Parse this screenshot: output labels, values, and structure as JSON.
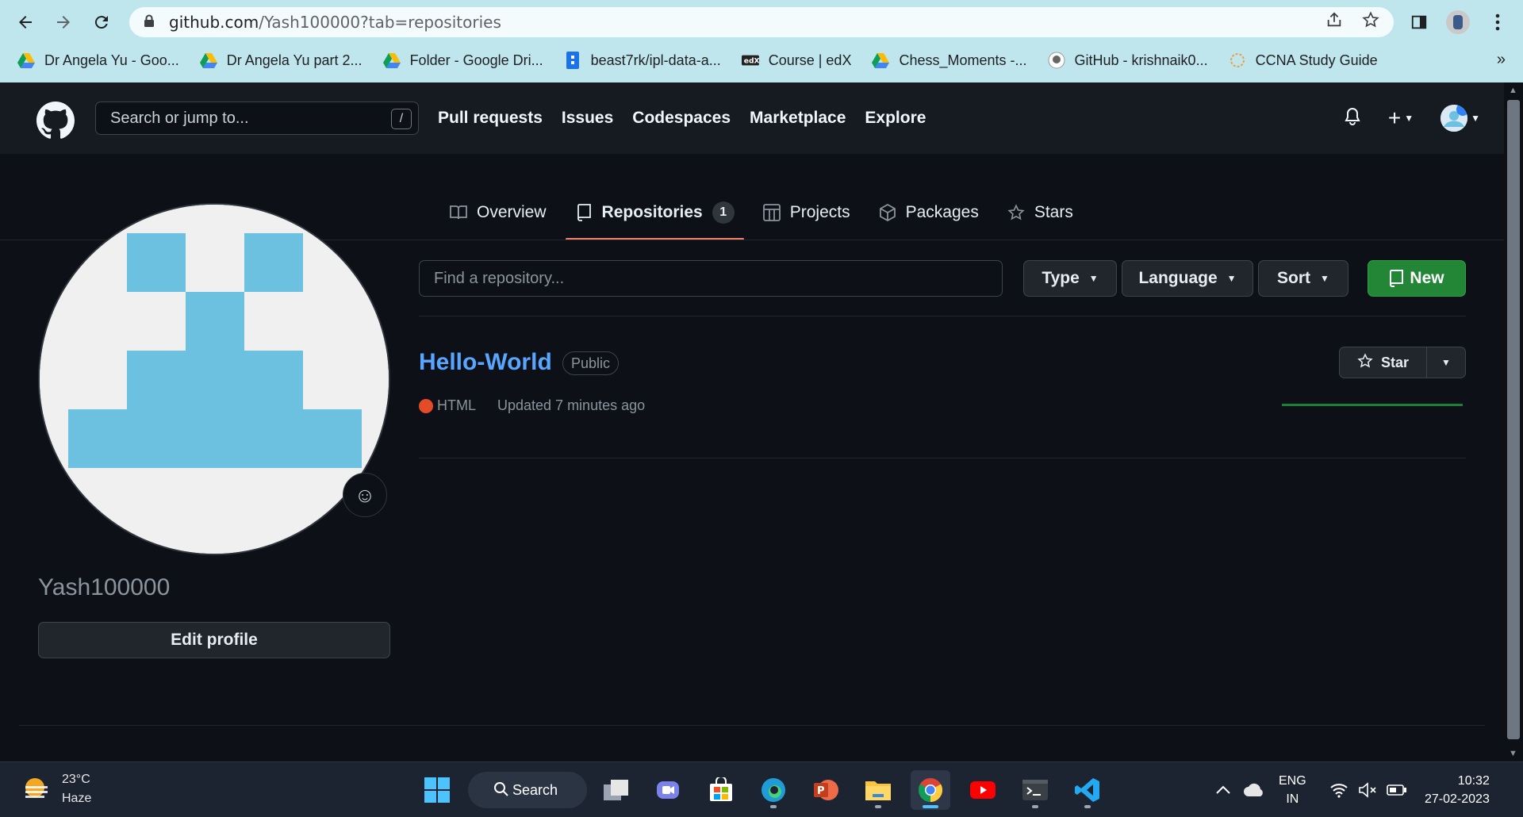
{
  "browser": {
    "url_main": "github.com",
    "url_rest": "/Yash100000?tab=repositories",
    "bookmarks": [
      {
        "label": "Dr Angela Yu - Goo...",
        "icon": "google-drive-icon"
      },
      {
        "label": "Dr Angela Yu part 2...",
        "icon": "google-drive-icon"
      },
      {
        "label": "Folder - Google Dri...",
        "icon": "google-drive-icon"
      },
      {
        "label": "beast7rk/ipl-data-a...",
        "icon": "doc-icon"
      },
      {
        "label": "Course | edX",
        "icon": "edx-icon"
      },
      {
        "label": "Chess_Moments -...",
        "icon": "google-drive-icon"
      },
      {
        "label": "GitHub - krishnaik0...",
        "icon": "github-icon"
      },
      {
        "label": "CCNA Study Guide",
        "icon": "loading-icon"
      }
    ],
    "more_label": "»"
  },
  "github": {
    "search_placeholder": "Search or jump to...",
    "search_shortcut": "/",
    "nav": [
      "Pull requests",
      "Issues",
      "Codespaces",
      "Marketplace",
      "Explore"
    ],
    "plus_label": "+",
    "tabs": [
      {
        "label": "Overview",
        "icon": "book-icon"
      },
      {
        "label": "Repositories",
        "icon": "repo-icon",
        "count": "1",
        "active": true
      },
      {
        "label": "Projects",
        "icon": "project-icon"
      },
      {
        "label": "Packages",
        "icon": "package-icon"
      },
      {
        "label": "Stars",
        "icon": "star-icon"
      }
    ],
    "profile": {
      "username": "Yash100000",
      "edit_label": "Edit profile",
      "emoji_icon": "☺"
    },
    "repo_filter": {
      "placeholder": "Find a repository...",
      "type_label": "Type",
      "language_label": "Language",
      "sort_label": "Sort",
      "new_label": "New"
    },
    "repos": [
      {
        "name": "Hello-World",
        "visibility": "Public",
        "language": "HTML",
        "language_color": "#e34c26",
        "updated": "Updated 7 minutes ago",
        "star_label": "Star"
      }
    ]
  },
  "taskbar": {
    "temperature": "23°C",
    "weather": "Haze",
    "search_label": "Search",
    "lang_top": "ENG",
    "lang_bottom": "IN",
    "time": "10:32",
    "date": "27-02-2023"
  },
  "colors": {
    "accent_green": "#238636",
    "link_blue": "#58a6ff",
    "tab_underline": "#f78166",
    "avatar_blue": "#6cc0e0"
  }
}
